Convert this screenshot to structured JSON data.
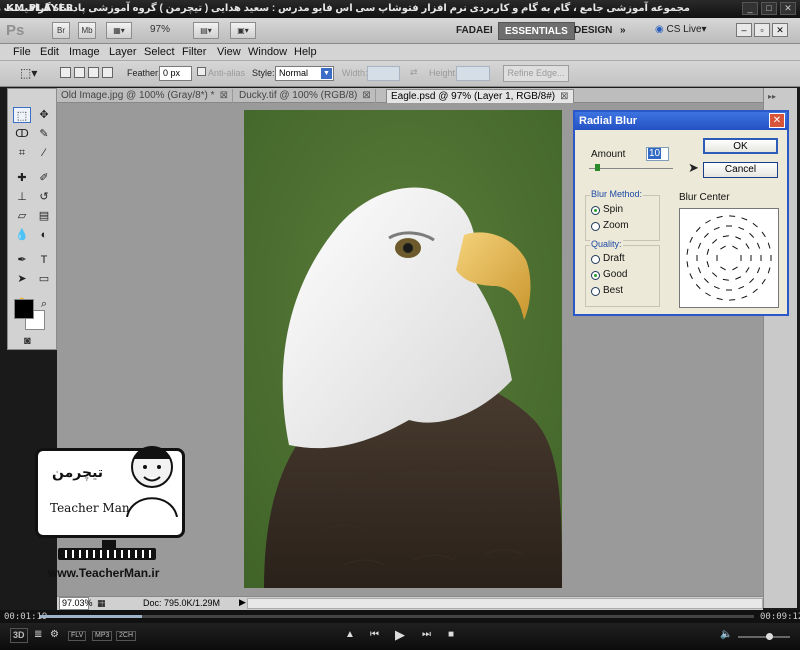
{
  "player": {
    "name": "KM PLAYER",
    "caption": "مجموعه آموزشی جامع ، گام به گام و کاربردی نرم افزار فتوشاپ سی اس فایو  مدرس : سعید هدایی ( تیچرمن ) گروه آموزشی پادشاه گرافیست ها",
    "window_controls": [
      "_",
      "□",
      "✕"
    ],
    "time_elapsed": "00:01:19",
    "time_total": "00:09:12",
    "progress": 0.143,
    "format_tags": [
      "3D",
      "FLV",
      "MP3",
      "2CH"
    ],
    "buttons": [
      "▲",
      "⏮",
      "▶",
      "⏭",
      "■"
    ]
  },
  "app": {
    "logo": "Ps",
    "bridge": "Br",
    "minibridge": "Mb",
    "zoom": "97%",
    "workspaces": [
      "FADAEI",
      "ESSENTIALS",
      "DESIGN"
    ],
    "more": "»",
    "cs_live": "CS Live"
  },
  "menu": [
    "File",
    "Edit",
    "Image",
    "Layer",
    "Select",
    "Filter",
    "View",
    "Window",
    "Help"
  ],
  "options": {
    "feather_label": "Feather:",
    "feather_value": "0 px",
    "antialias_label": "Anti-alias",
    "style_label": "Style:",
    "style_value": "Normal",
    "width_label": "Width:",
    "height_label": "Height:",
    "refine_label": "Refine Edge..."
  },
  "tabs": [
    {
      "label": "Old Image.jpg @ 100% (Gray/8*) *"
    },
    {
      "label": "Ducky.tif @ 100% (RGB/8)"
    },
    {
      "label": "Eagle.psd @ 97% (Layer 1, RGB/8#)"
    }
  ],
  "status": {
    "zoom": "97.03%",
    "doc": "Doc: 795.0K/1.29M"
  },
  "dialog": {
    "title": "Radial Blur",
    "amount_label": "Amount",
    "amount_value": "10",
    "ok": "OK",
    "cancel": "Cancel",
    "blur_center_label": "Blur Center",
    "blur_method_label": "Blur Method:",
    "spin": "Spin",
    "zoom": "Zoom",
    "quality_label": "Quality:",
    "draft": "Draft",
    "good": "Good",
    "best": "Best",
    "selected_method": "Spin",
    "selected_quality": "Good"
  },
  "watermark": {
    "fa": "تیچرمن",
    "en": "Teacher Man",
    "url": "www.TeacherMan.ir"
  },
  "tools": [
    "marquee-icon",
    "move-icon",
    "lasso-icon",
    "quick-select-icon",
    "crop-icon",
    "eyedropper-icon",
    "spot-heal-icon",
    "brush-icon",
    "clone-stamp-icon",
    "history-brush-icon",
    "eraser-icon",
    "gradient-icon",
    "blur-tool-icon",
    "dodge-icon",
    "pen-icon",
    "type-icon",
    "path-select-icon",
    "shape-icon",
    "hand-icon",
    "zoom-tool-icon"
  ]
}
